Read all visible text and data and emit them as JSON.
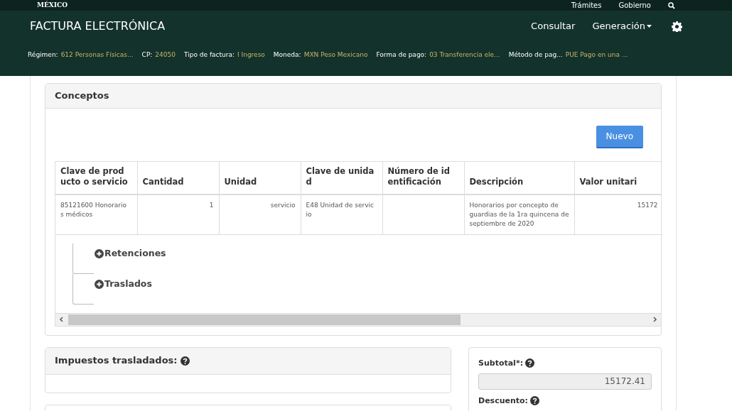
{
  "top_bar": {
    "logo_text": "MÉXICO",
    "links": [
      "Trámites",
      "Gobierno"
    ]
  },
  "navbar": {
    "brand": "FACTURA ELECTRÓNICA",
    "items": [
      {
        "label": "Consultar",
        "dropdown": false
      },
      {
        "label": "Generación",
        "dropdown": true
      }
    ]
  },
  "summary": [
    {
      "label": "Régimen:",
      "value": "612 Personas Físicas..."
    },
    {
      "label": "CP:",
      "value": "24050"
    },
    {
      "label": "Tipo de factura:",
      "value": "I Ingreso"
    },
    {
      "label": "Moneda:",
      "value": "MXN Peso Mexicano"
    },
    {
      "label": "Forma de pago:",
      "value": "03 Transferencia ele..."
    },
    {
      "label": "Método de pag...",
      "value": "PUE Pago en una ..."
    }
  ],
  "conceptos": {
    "title": "Conceptos",
    "new_button": "Nuevo",
    "columns": [
      "Clave de prod ucto o servicio",
      "Cantidad",
      "Unidad",
      "Clave de unida d",
      "Número de id entificación",
      "Descripción",
      "Valor unitari"
    ],
    "rows": [
      [
        "85121600 Honorario s médicos",
        "1",
        "servicio",
        "E48 Unidad de servic io",
        "",
        "Honorarios por concepto de guardias de la 1ra quincena de septiembre de 2020",
        "15172"
      ]
    ],
    "tree": [
      {
        "label": "Retenciones",
        "expanded": false
      },
      {
        "label": "Traslados",
        "expanded": false
      }
    ]
  },
  "impuestos": {
    "title": "Impuestos trasladados:"
  },
  "totals": [
    {
      "label": "Subtotal*:",
      "value": "15172.41",
      "disabled": true
    },
    {
      "label": "Descuento:"
    }
  ]
}
